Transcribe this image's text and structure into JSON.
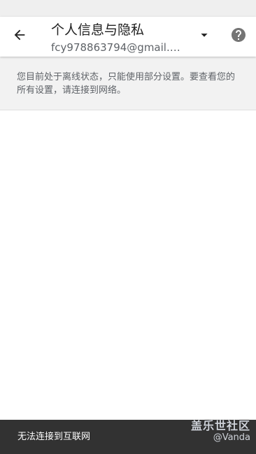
{
  "header": {
    "title": "个人信息与隐私",
    "account_email": "fcy978863794@gmail.com"
  },
  "icons": {
    "back": "arrow-back-icon",
    "dropdown": "arrow-drop-down-icon",
    "help": "help-circle-icon"
  },
  "offline_banner": {
    "message": "您目前处于离线状态，只能使用部分设置。要查看您的所有设置，请连接到网络。"
  },
  "snackbar": {
    "message": "无法连接到互联网"
  },
  "watermark": {
    "site": "盖乐世社区",
    "author": "@Vanda"
  },
  "colors": {
    "status_bar": "#efefef",
    "banner_bg": "#f2f2f2",
    "snackbar_bg": "#323232",
    "icon_dark": "#212121",
    "help_icon": "#757575"
  }
}
